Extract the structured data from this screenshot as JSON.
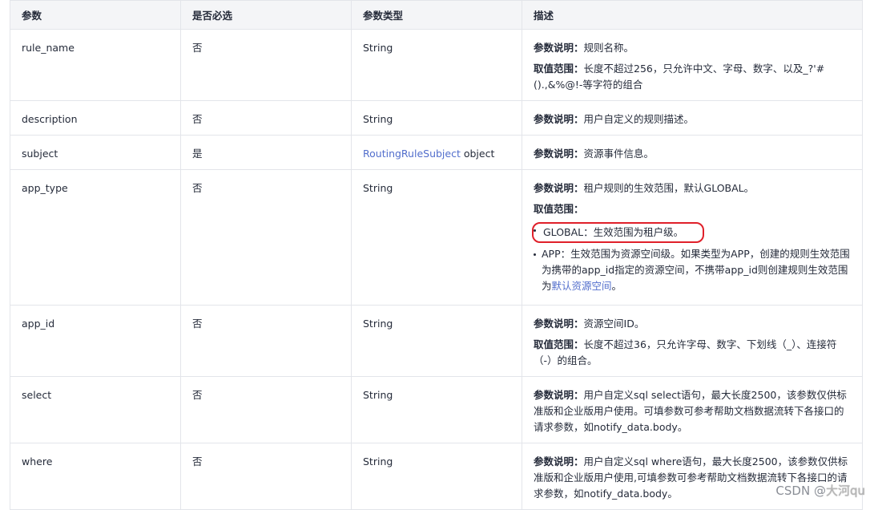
{
  "headers": [
    "参数",
    "是否必选",
    "参数类型",
    "描述"
  ],
  "rows": [
    {
      "name": "rule_name",
      "required": "否",
      "type": "String",
      "desc_label_1": "参数说明：",
      "desc_text_1": "规则名称。",
      "desc_label_2": "取值范围：",
      "desc_text_2": "长度不超过256，只允许中文、字母、数字、以及_?'#().,&%@!-等字符的组合"
    },
    {
      "name": "description",
      "required": "否",
      "type": "String",
      "desc_label_1": "参数说明：",
      "desc_text_1": "用户自定义的规则描述。"
    },
    {
      "name": "subject",
      "required": "是",
      "type_link": "RoutingRuleSubject",
      "type_suffix": " object",
      "desc_label_1": "参数说明：",
      "desc_text_1": "资源事件信息。"
    },
    {
      "name": "app_type",
      "required": "否",
      "type": "String",
      "desc_label_1": "参数说明：",
      "desc_text_1": "租户规则的生效范围，默认GLOBAL。",
      "desc_label_2": "取值范围：",
      "bullet_1": "GLOBAL：生效范围为租户级。",
      "bullet_2_text": "APP：生效范围为资源空间级。如果类型为APP，创建的规则生效范围为携带的app_id指定的资源空间，不携带app_id则创建规则生效范围为",
      "bullet_2_link": "默认资源空间",
      "bullet_2_end": "。"
    },
    {
      "name": "app_id",
      "required": "否",
      "type": "String",
      "desc_label_1": "参数说明：",
      "desc_text_1": "资源空间ID。",
      "desc_label_2": "取值范围：",
      "desc_text_2": "长度不超过36，只允许字母、数字、下划线（_）、连接符（-）的组合。"
    },
    {
      "name": "select",
      "required": "否",
      "type": "String",
      "desc_label_1": "参数说明：",
      "desc_text_1": "用户自定义sql select语句，最大长度2500，该参数仅供标准版和企业版用户使用。可填参数可参考帮助文档数据流转下各接口的请求参数，如notify_data.body。"
    },
    {
      "name": "where",
      "required": "否",
      "type": "String",
      "desc_label_1": "参数说明：",
      "desc_text_1": "用户自定义sql where语句，最大长度2500，该参数仅供标准版和企业版用户使用,可填参数可参考帮助文档数据流转下各接口的请求参数，如notify_data.body。"
    }
  ],
  "watermark": {
    "prefix": "CSDN @",
    "name": "大河qu"
  }
}
